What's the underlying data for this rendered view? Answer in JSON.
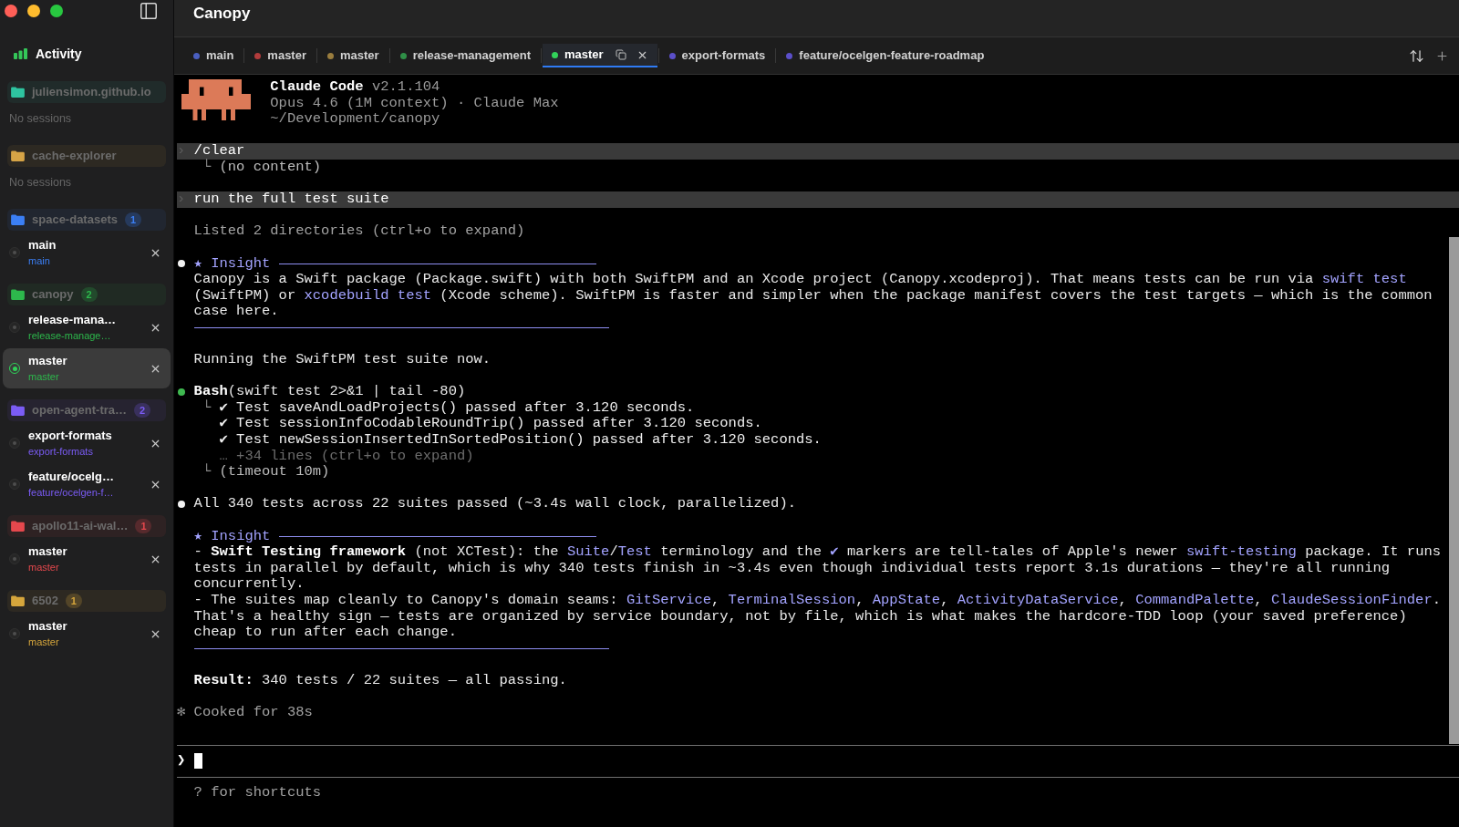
{
  "window": {
    "title": "Canopy"
  },
  "sidebar": {
    "activity": {
      "label": "Activity"
    },
    "groups": [
      {
        "name": "juliensimon.github.io",
        "color": "#2ec4a0",
        "empty_text": "No sessions"
      },
      {
        "name": "cache-explorer",
        "color": "#d6a446",
        "empty_text": "No sessions"
      },
      {
        "name": "space-datasets",
        "color": "#3b7ff5",
        "count": "1",
        "sessions": [
          {
            "title": "main",
            "branch": "main",
            "selected": false,
            "active": false
          }
        ]
      },
      {
        "name": "canopy",
        "color": "#2db84c",
        "count": "2",
        "sessions": [
          {
            "title": "release-mana…",
            "branch": "release-manage…",
            "selected": false,
            "active": false
          },
          {
            "title": "master",
            "branch": "master",
            "selected": true,
            "active": true
          }
        ]
      },
      {
        "name": "open-agent-tra…",
        "color": "#7b5cf6",
        "count": "2",
        "sessions": [
          {
            "title": "export-formats",
            "branch": "export-formats",
            "selected": false,
            "active": false
          },
          {
            "title": "feature/ocelg…",
            "branch": "feature/ocelgen-f…",
            "selected": false,
            "active": false
          }
        ]
      },
      {
        "name": "apollo11-ai-wal…",
        "color": "#e5484d",
        "count": "1",
        "sessions": [
          {
            "title": "master",
            "branch": "master",
            "selected": false,
            "active": false
          }
        ]
      },
      {
        "name": "6502",
        "color": "#d6a63c",
        "count": "1",
        "sessions": [
          {
            "title": "master",
            "branch": "master",
            "selected": false,
            "active": false
          }
        ]
      }
    ]
  },
  "tabs": [
    {
      "label": "main",
      "color": "#4a5fc0",
      "selected": false
    },
    {
      "label": "master",
      "color": "#b23c3c",
      "selected": false
    },
    {
      "label": "master",
      "color": "#9a7d3e",
      "selected": false
    },
    {
      "label": "release-management",
      "color": "#2f8f47",
      "selected": false
    },
    {
      "label": "master",
      "color": "#32d25a",
      "selected": true
    },
    {
      "label": "export-formats",
      "color": "#5b4fc9",
      "selected": false
    },
    {
      "label": "feature/ocelgen-feature-roadmap",
      "color": "#5b4fc9",
      "selected": false
    }
  ],
  "terminal": {
    "header": {
      "app": "Claude Code",
      "version": "v2.1.104",
      "model": "Opus 4.6 (1M context) · Claude Max",
      "path": "~/Development/canopy"
    },
    "entries": [
      {
        "kind": "command",
        "symbol": "›",
        "text": "/clear",
        "output": [
          {
            "kind": "result",
            "glyph": "└",
            "text": [
              "(no content)"
            ]
          }
        ]
      },
      {
        "kind": "command",
        "symbol": "›",
        "text": "run the full test suite"
      },
      {
        "kind": "note",
        "text": "Listed 2 directories (ctrl+o to expand)"
      },
      {
        "kind": "insight",
        "color": "#f2f2f2",
        "symbol": "★",
        "title": "Insight",
        "lines": [
          [
            "Canopy is a Swift package (Package.swift) with both SwiftPM and an Xcode project (Canopy.xcodeproj). That means tests can be run via ",
            {
              "code": "swift test"
            }
          ],
          [
            "(SwiftPM) or ",
            {
              "code": "xcodebuild test"
            },
            " (Xcode scheme). SwiftPM is faster and simpler when the package manifest covers the test targets — which is the common"
          ],
          [
            "case here."
          ]
        ]
      },
      {
        "kind": "message",
        "lines": [
          [
            "Running the SwiftPM test suite now."
          ]
        ]
      },
      {
        "kind": "tool",
        "color": "#3fb950",
        "call": [
          {
            "bold": "Bash"
          },
          "(swift test 2>&1 | tail -80)"
        ],
        "output": [
          {
            "kind": "test",
            "glyph": "└",
            "text": [
              "✔ Test saveAndLoadProjects() passed after 3.120 seconds."
            ]
          },
          {
            "kind": "test",
            "text": [
              "✔ Test sessionInfoCodableRoundTrip() passed after 3.120 seconds."
            ]
          },
          {
            "kind": "test",
            "text": [
              "✔ Test newSessionInsertedInSortedPosition() passed after 3.120 seconds."
            ]
          },
          {
            "kind": "collapsed",
            "text": [
              "… +34 lines (ctrl+o to expand)"
            ]
          },
          {
            "kind": "result",
            "glyph": "└",
            "text": [
              "(timeout 10m)"
            ]
          }
        ]
      },
      {
        "kind": "message",
        "color": "#f2f2f2",
        "lines": [
          [
            "All 340 tests across 22 suites passed (~3.4s wall clock, parallelized)."
          ]
        ]
      },
      {
        "kind": "insight",
        "symbol": "★",
        "title": "Insight",
        "lines": [
          [
            "- ",
            {
              "bold": "Swift Testing framework"
            },
            " (not XCTest): the ",
            {
              "code": "Suite"
            },
            "/",
            {
              "code": "Test"
            },
            " terminology and the ",
            {
              "code": "✔"
            },
            " markers are tell-tales of Apple's newer ",
            {
              "code": "swift-testing"
            },
            " package. It runs"
          ],
          [
            "tests in parallel by default, which is why 340 tests finish in ~3.4s even though individual tests report 3.1s durations — they're all running"
          ],
          [
            "concurrently."
          ],
          [
            "- The suites map cleanly to Canopy's domain seams: ",
            {
              "code": "GitService"
            },
            ", ",
            {
              "code": "TerminalSession"
            },
            ", ",
            {
              "code": "AppState"
            },
            ", ",
            {
              "code": "ActivityDataService"
            },
            ", ",
            {
              "code": "CommandPalette"
            },
            ", ",
            {
              "code": "ClaudeSessionFinder"
            },
            "."
          ],
          [
            "That's a healthy sign — tests are organized by service boundary, not by file, which is what makes the hardcore-TDD loop (your saved preference)"
          ],
          [
            "cheap to run after each change."
          ]
        ]
      },
      {
        "kind": "message",
        "lines": [
          [
            {
              "bold": "Result:"
            },
            " 340 tests / 22 suites — all passing."
          ]
        ]
      },
      {
        "kind": "summary",
        "symbol": "✻",
        "text": "Cooked for 38s"
      }
    ],
    "prompt": {
      "symbol": "❯"
    },
    "hint": "? for shortcuts"
  }
}
